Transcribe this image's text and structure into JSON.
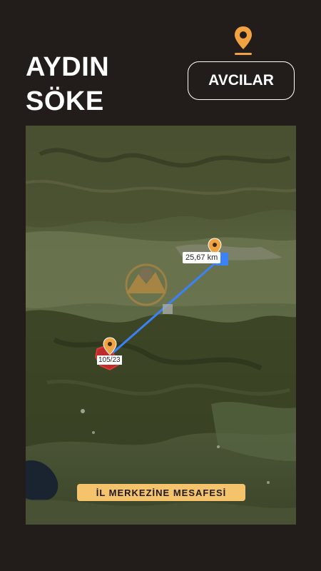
{
  "header": {
    "province": "AYDIN",
    "district": "SÖKE",
    "neighborhood_button": "AVCILAR"
  },
  "map": {
    "distance_label": "25,67 km",
    "parcel_label": "105/23",
    "caption": "İL MERKEZİNE MESAFESİ",
    "route_color": "#3b82f6",
    "parcel_color": "#d9262c",
    "pin_color": "#f2a341",
    "location_pin_icon": "map-pin-icon"
  },
  "colors": {
    "background": "#221d1b",
    "caption_bg": "#f6c36d"
  }
}
